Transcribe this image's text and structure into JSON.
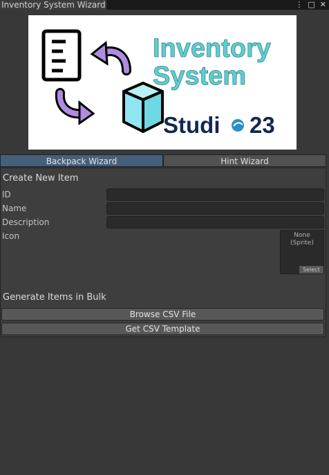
{
  "window": {
    "tab_title": "Inventory System Wizard",
    "controls": {
      "menu": "⋮",
      "maximize": "□",
      "close": "✕"
    }
  },
  "banner": {
    "title_line1": "Inventory",
    "title_line2": "System",
    "brand_part1": "Studi",
    "brand_part2": "23",
    "colors": {
      "title": "#5fcfcf",
      "brand": "#13284e",
      "brand_dot": "#2a8fc4",
      "arrow": "#b08ce0",
      "cube": "#8fe6f0"
    }
  },
  "wizard_tabs": [
    {
      "label": "Backpack Wizard",
      "active": true
    },
    {
      "label": "Hint Wizard",
      "active": false
    }
  ],
  "create_item": {
    "heading": "Create New Item",
    "fields": [
      {
        "label": "ID",
        "value": ""
      },
      {
        "label": "Name",
        "value": ""
      },
      {
        "label": "Description",
        "value": ""
      }
    ],
    "icon_label": "Icon",
    "sprite": {
      "none_line1": "None",
      "none_line2": "(Sprite)",
      "select_label": "Select"
    }
  },
  "bulk": {
    "heading": "Generate Items in Bulk",
    "browse_label": "Browse CSV File",
    "template_label": "Get CSV Template"
  }
}
